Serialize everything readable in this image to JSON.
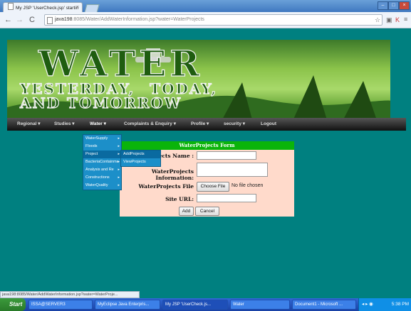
{
  "browser": {
    "tab_title": "My JSP 'UserCheck.jsp' startin",
    "url_host": "java198",
    "url_rest": ":8085/Water/AddWaterInformation.jsp?water=WaterProjects",
    "status_text": "java198:8085/Water/AddWaterInformation.jsp?water=WaterProje..."
  },
  "banner": {
    "title": "WATER",
    "subtitle_line1": "YESTERDAY, TODAY,",
    "subtitle_line2": "AND TOMORROW"
  },
  "nav": [
    "Regional",
    "Studies",
    "Water",
    "Complaints & Enquiry",
    "Profile",
    "security",
    "Logout"
  ],
  "water_menu": [
    "WaterSupply",
    "Floods",
    "Project",
    "BacteriaContainme",
    "Analysis and Re",
    "Constructions",
    "WaterQuality"
  ],
  "project_submenu": [
    "AddProjects",
    "ViewProjects"
  ],
  "form": {
    "heading": "WaterProjects Form",
    "name_label": "WaterProjects Name :",
    "info_label": "WaterProjects Information:",
    "file_label": "WaterProjects File",
    "choose_file": "Choose File",
    "no_file": "No file chosen",
    "site_label": "Site URL:",
    "add_button": "Add",
    "cancel_button": "Cancel"
  },
  "taskbar": {
    "start": "Start",
    "items": [
      "ISSA@SERVER3",
      "MyEclipse Java Enterpris...",
      "My JSP 'UserCheck.js...",
      "Water",
      "Document1 - Microsoft ..."
    ],
    "clock": "5:38 PM"
  }
}
